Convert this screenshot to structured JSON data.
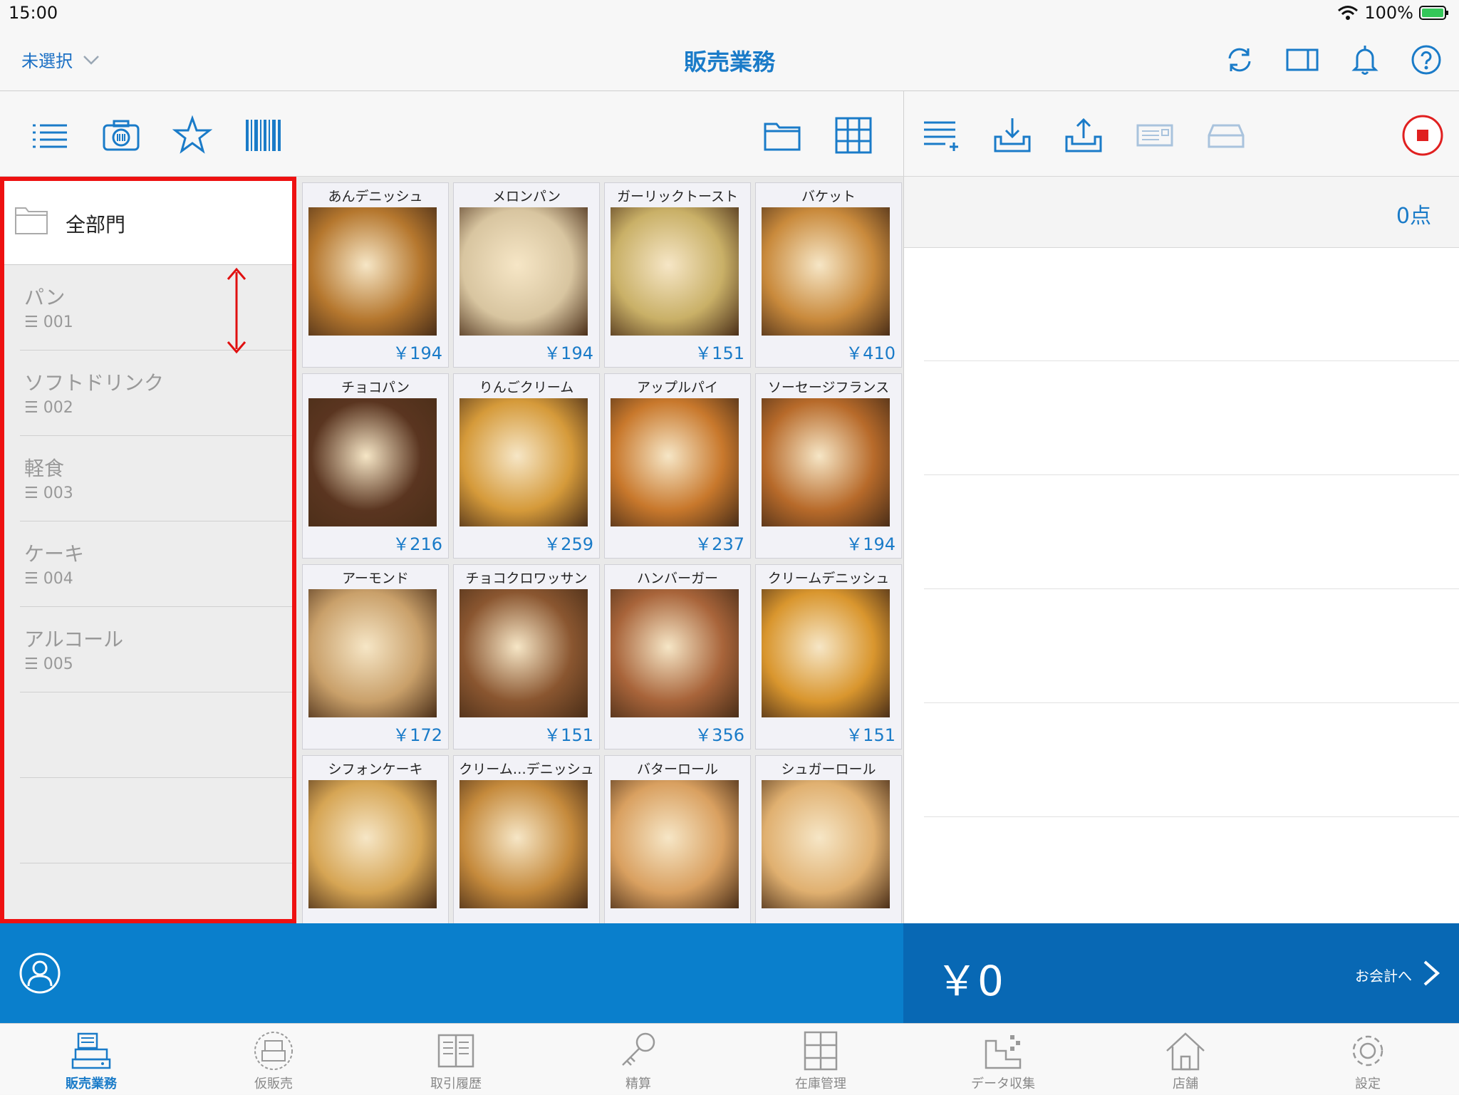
{
  "status_bar": {
    "time": "15:00",
    "battery": "100%"
  },
  "nav": {
    "store_selector": "未選択",
    "title": "販売業務"
  },
  "departments": {
    "all_label": "全部門",
    "items": [
      {
        "name": "パン",
        "code": "001"
      },
      {
        "name": "ソフトドリンク",
        "code": "002"
      },
      {
        "name": "軽食",
        "code": "003"
      },
      {
        "name": "ケーキ",
        "code": "004"
      },
      {
        "name": "アルコール",
        "code": "005"
      }
    ]
  },
  "products": [
    {
      "name": "あんデニッシュ",
      "price": "￥194",
      "color": "#b5772e"
    },
    {
      "name": "メロンパン",
      "price": "￥194",
      "color": "#d8c5a0"
    },
    {
      "name": "ガーリックトースト",
      "price": "￥151",
      "color": "#c9b067"
    },
    {
      "name": "バケット",
      "price": "￥410",
      "color": "#c98a3c"
    },
    {
      "name": "チョコパン",
      "price": "￥216",
      "color": "#5a3520"
    },
    {
      "name": "りんごクリーム",
      "price": "￥259",
      "color": "#d59a3a"
    },
    {
      "name": "アップルパイ",
      "price": "￥237",
      "color": "#c8782c"
    },
    {
      "name": "ソーセージフランス",
      "price": "￥194",
      "color": "#b76a2a"
    },
    {
      "name": "アーモンド",
      "price": "￥172",
      "color": "#c9a06a"
    },
    {
      "name": "チョコクロワッサン",
      "price": "￥151",
      "color": "#8a5630"
    },
    {
      "name": "ハンバーガー",
      "price": "￥356",
      "color": "#a8643a"
    },
    {
      "name": "クリームデニッシュ",
      "price": "￥151",
      "color": "#d9962e"
    },
    {
      "name": "シフォンケーキ",
      "price": "",
      "color": "#d6a554"
    },
    {
      "name": "クリーム…デニッシュ",
      "price": "",
      "color": "#c58a3c"
    },
    {
      "name": "バターロール",
      "price": "",
      "color": "#d9a060"
    },
    {
      "name": "シュガーロール",
      "price": "",
      "color": "#e0b070"
    }
  ],
  "cart": {
    "count": "0点",
    "total": "￥0",
    "checkout_label": "お会計へ"
  },
  "tabs": [
    {
      "label": "販売業務",
      "icon": "register-icon",
      "active": true
    },
    {
      "label": "仮販売",
      "icon": "temp-sale-icon"
    },
    {
      "label": "取引履歴",
      "icon": "history-icon"
    },
    {
      "label": "精算",
      "icon": "key-icon"
    },
    {
      "label": "在庫管理",
      "icon": "inventory-icon"
    },
    {
      "label": "データ収集",
      "icon": "data-collect-icon"
    },
    {
      "label": "店舗",
      "icon": "store-icon"
    },
    {
      "label": "設定",
      "icon": "gear-icon"
    }
  ],
  "colors": {
    "accent": "#1a7bc8",
    "bar_blue": "#0a7fcc",
    "total_blue": "#0868b4",
    "highlight": "#ee1111"
  }
}
